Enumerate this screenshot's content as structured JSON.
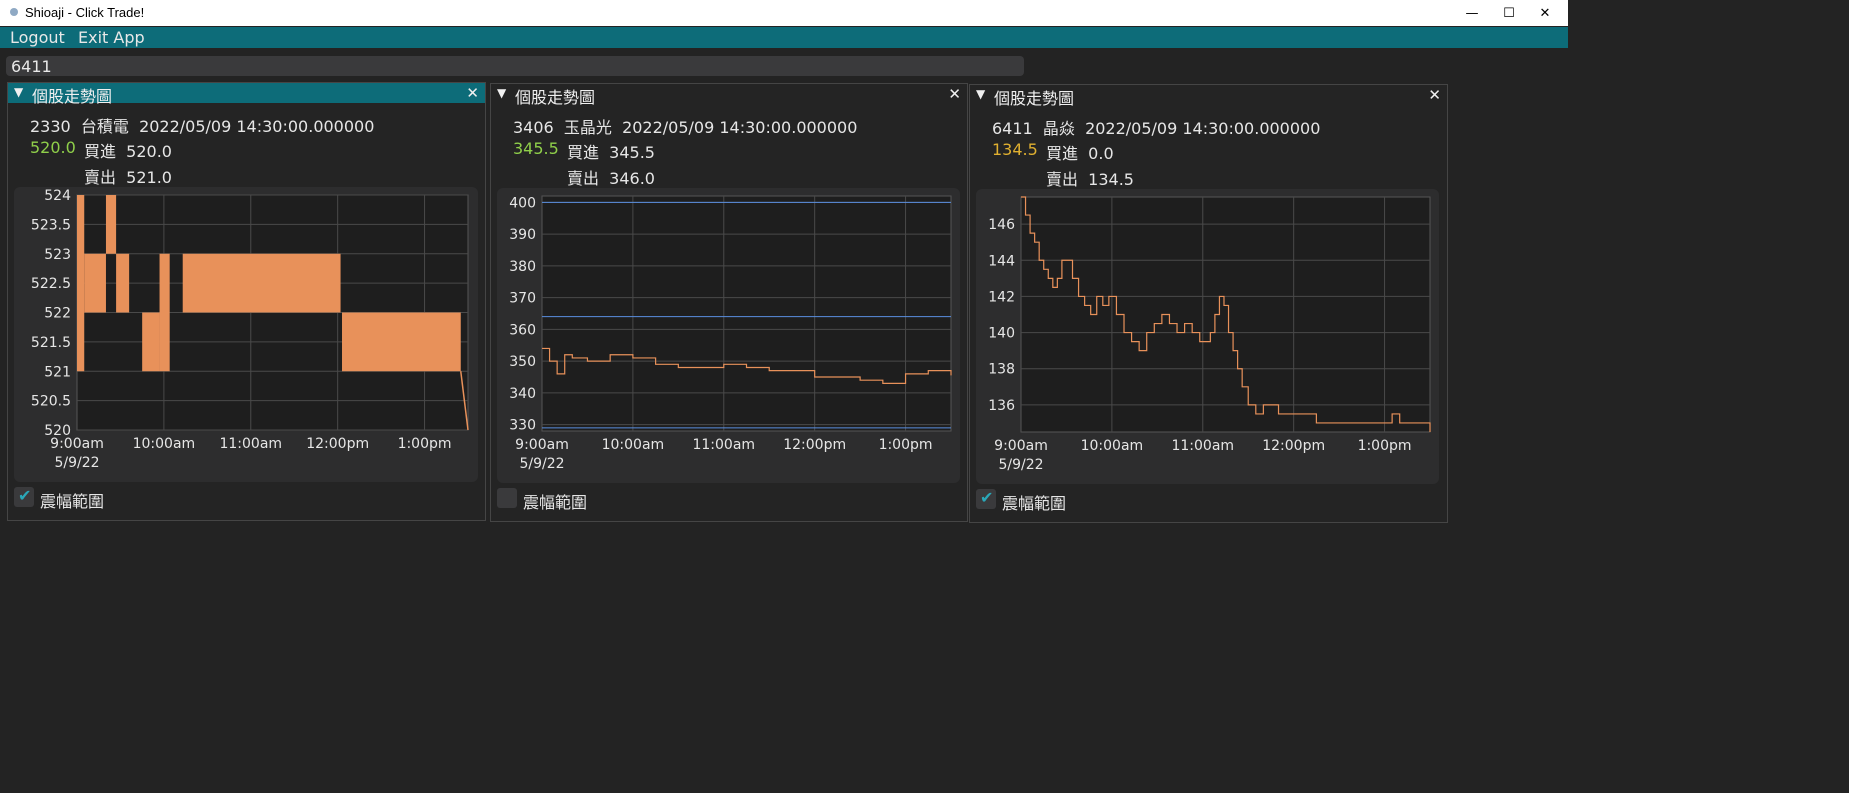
{
  "window": {
    "title": "Shioaji - Click Trade!",
    "minimize": "—",
    "maximize": "☐",
    "close": "✕"
  },
  "menu": {
    "logout": "Logout",
    "exit": "Exit App"
  },
  "search": {
    "value": "6411"
  },
  "panels": [
    {
      "title": "個股走勢圖",
      "close": "✕",
      "header_line": "2330  台積電  2022/05/09 14:30:00.000000",
      "last": "520.0",
      "last_color": "#8fcf4a",
      "bid": "買進  520.0",
      "ask": "賣出  521.0",
      "checkbox_label": "震幅範圍",
      "checked": true
    },
    {
      "title": "個股走勢圖",
      "close": "✕",
      "header_line": "3406  玉晶光  2022/05/09 14:30:00.000000",
      "last": "345.5",
      "last_color": "#8fcf4a",
      "bid": "買進  345.5",
      "ask": "賣出  346.0",
      "checkbox_label": "震幅範圍",
      "checked": false
    },
    {
      "title": "個股走勢圖",
      "close": "✕",
      "header_line": "6411  晶焱  2022/05/09 14:30:00.000000",
      "last": "134.5",
      "last_color": "#e0b030",
      "bid": "買進  0.0",
      "ask": "賣出  134.5",
      "checkbox_label": "震幅範圍",
      "checked": true
    }
  ],
  "chart_data": [
    {
      "type": "line",
      "series_color": "#e8915a",
      "xlim": [
        "9:00",
        "13:30"
      ],
      "x_ticks": [
        "9:00am",
        "10:00am",
        "11:00am",
        "12:00pm",
        "1:00pm"
      ],
      "x_sub": "5/9/22",
      "ylim": [
        520,
        524
      ],
      "y_ticks": [
        "524",
        "523.5",
        "523",
        "522.5",
        "522",
        "521.5",
        "521",
        "520.5",
        "520"
      ],
      "segments": [
        {
          "from": "9:00",
          "to": "9:05",
          "low": 521,
          "high": 524
        },
        {
          "from": "9:05",
          "to": "9:20",
          "low": 522,
          "high": 523
        },
        {
          "from": "9:20",
          "to": "9:27",
          "low": 523,
          "high": 524
        },
        {
          "from": "9:27",
          "to": "9:36",
          "low": 522,
          "high": 523
        },
        {
          "from": "9:45",
          "to": "9:57",
          "low": 521,
          "high": 522
        },
        {
          "from": "9:57",
          "to": "10:04",
          "low": 521,
          "high": 523
        },
        {
          "from": "10:13",
          "to": "12:02",
          "low": 522,
          "high": 523
        },
        {
          "from": "12:03",
          "to": "13:25",
          "low": 521,
          "high": 522
        }
      ],
      "last": {
        "time": "13:30",
        "value": 520
      }
    },
    {
      "type": "line",
      "series_color": "#e8915a",
      "xlim": [
        "9:00",
        "13:30"
      ],
      "x_ticks": [
        "9:00am",
        "10:00am",
        "11:00am",
        "12:00pm",
        "1:00pm"
      ],
      "x_sub": "5/9/22",
      "ylim": [
        328,
        402
      ],
      "y_ticks": [
        "400",
        "390",
        "380",
        "370",
        "360",
        "350",
        "340",
        "330"
      ],
      "ref_lines": [
        {
          "value": 400,
          "color": "#5a8fe0"
        },
        {
          "value": 364,
          "color": "#5a8fe0"
        },
        {
          "value": 329,
          "color": "#5a8fe0"
        }
      ],
      "x": [
        "9:00",
        "9:05",
        "9:10",
        "9:15",
        "9:20",
        "9:30",
        "9:45",
        "10:00",
        "10:15",
        "10:30",
        "10:45",
        "11:00",
        "11:15",
        "11:30",
        "11:45",
        "12:00",
        "12:15",
        "12:30",
        "12:45",
        "13:00",
        "13:15",
        "13:30"
      ],
      "values": [
        354,
        350,
        346,
        352,
        351,
        350,
        352,
        351,
        349,
        348,
        348,
        349,
        348,
        347,
        347,
        345,
        345,
        344,
        343,
        346,
        347,
        345.5
      ]
    },
    {
      "type": "line",
      "series_color": "#e8915a",
      "xlim": [
        "9:00",
        "13:30"
      ],
      "x_ticks": [
        "9:00am",
        "10:00am",
        "11:00am",
        "12:00pm",
        "1:00pm"
      ],
      "x_sub": "5/9/22",
      "ylim": [
        134.5,
        147.5
      ],
      "y_ticks": [
        "146",
        "144",
        "142",
        "140",
        "138",
        "136"
      ],
      "x": [
        "9:00",
        "9:03",
        "9:06",
        "9:09",
        "9:12",
        "9:15",
        "9:18",
        "9:21",
        "9:24",
        "9:27",
        "9:30",
        "9:34",
        "9:38",
        "9:42",
        "9:46",
        "9:50",
        "9:54",
        "9:58",
        "10:03",
        "10:08",
        "10:13",
        "10:18",
        "10:23",
        "10:28",
        "10:33",
        "10:38",
        "10:43",
        "10:48",
        "10:53",
        "10:58",
        "11:02",
        "11:05",
        "11:08",
        "11:11",
        "11:14",
        "11:17",
        "11:20",
        "11:23",
        "11:26",
        "11:30",
        "11:35",
        "11:40",
        "11:50",
        "12:00",
        "12:15",
        "12:30",
        "12:45",
        "13:00",
        "13:05",
        "13:10",
        "13:20",
        "13:30"
      ],
      "values": [
        147.5,
        146.5,
        145.5,
        145,
        144,
        143.5,
        143,
        142.5,
        143,
        144,
        144,
        143,
        142,
        141.5,
        141,
        142,
        141.5,
        142,
        141,
        140,
        139.5,
        139,
        140,
        140.5,
        141,
        140.5,
        140,
        140.5,
        140,
        139.5,
        139.5,
        140,
        141,
        142,
        141.5,
        140,
        139,
        138,
        137,
        136,
        135.5,
        136,
        135.5,
        135.5,
        135,
        135,
        135,
        135,
        135.5,
        135,
        135,
        134.5
      ]
    }
  ]
}
